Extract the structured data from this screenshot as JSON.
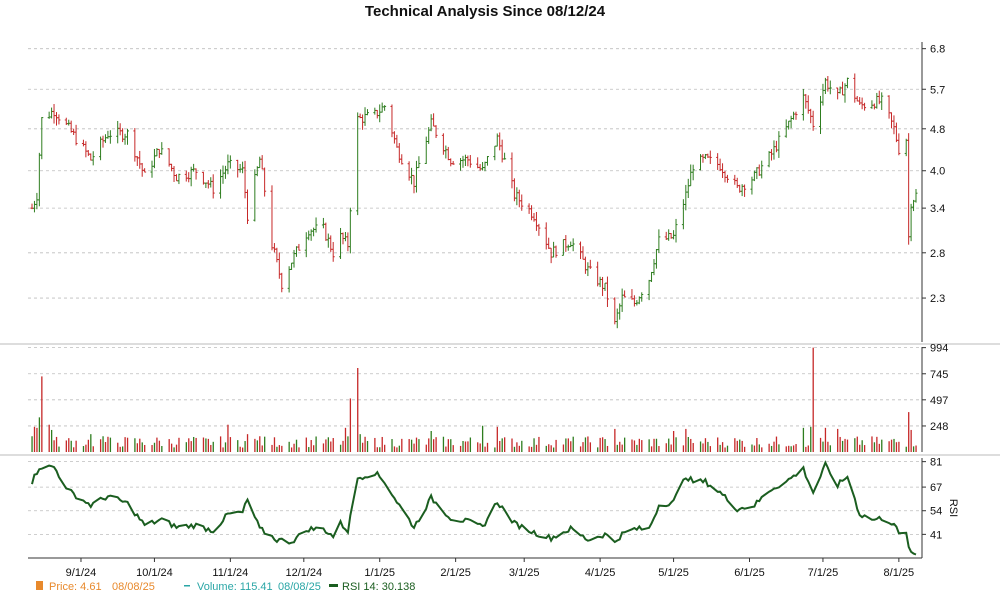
{
  "chart_data": {
    "type": "ohlc",
    "title": "Technical Analysis Since 08/12/24",
    "colors": {
      "up": "#2e7d1f",
      "down": "#c62828",
      "volume": "#c62828",
      "volume_up": "#2e7d1f",
      "rsi": "#1b5e20",
      "price_legend": "#e8892c",
      "volume_legend": "#2aa6a6",
      "rsi_legend": "#1b5e20"
    },
    "panels": {
      "price": {
        "ylim": [
          1.9,
          7.0
        ],
        "y_ticks": [
          "6.8",
          "5.7",
          "4.8",
          "4.0",
          "3.4",
          "2.8",
          "2.3"
        ],
        "y_tick_values": [
          6.8,
          5.7,
          4.8,
          4.0,
          3.4,
          2.8,
          2.3
        ],
        "scale": "log",
        "grid": true
      },
      "volume": {
        "ylim": [
          0,
          1000
        ],
        "y_ticks": [
          "994",
          "745",
          "497",
          "248"
        ],
        "y_tick_values": [
          994,
          745,
          497,
          248
        ],
        "grid": true
      },
      "rsi": {
        "ylim": [
          28,
          83
        ],
        "y_ticks": [
          "81",
          "67",
          "54",
          "41"
        ],
        "y_tick_values": [
          81,
          67,
          54,
          41
        ],
        "ylabel": "RSI",
        "grid": true
      }
    },
    "x_ticks": [
      "9/1/24",
      "10/1/24",
      "11/1/24",
      "12/1/24",
      "1/1/25",
      "2/1/25",
      "3/1/25",
      "4/1/25",
      "5/1/25",
      "6/1/25",
      "7/1/25",
      "8/1/25"
    ],
    "x_tick_dates": [
      "2024-09-01",
      "2024-10-01",
      "2024-11-01",
      "2024-12-01",
      "2025-01-01",
      "2025-02-01",
      "2025-03-01",
      "2025-04-01",
      "2025-05-01",
      "2025-06-01",
      "2025-07-01",
      "2025-08-01"
    ],
    "date_range": [
      "2024-08-12",
      "2025-08-08"
    ],
    "price_anchors": [
      [
        "2024-08-12",
        3.4
      ],
      [
        "2024-08-14",
        3.6
      ],
      [
        "2024-08-16",
        5.0
      ],
      [
        "2024-08-21",
        5.2
      ],
      [
        "2024-08-27",
        4.8
      ],
      [
        "2024-09-05",
        4.2
      ],
      [
        "2024-09-12",
        4.7
      ],
      [
        "2024-09-20",
        4.7
      ],
      [
        "2024-09-27",
        3.9
      ],
      [
        "2024-10-03",
        4.4
      ],
      [
        "2024-10-10",
        3.9
      ],
      [
        "2024-10-18",
        4.0
      ],
      [
        "2024-10-25",
        3.7
      ],
      [
        "2024-10-31",
        4.1
      ],
      [
        "2024-11-06",
        4.0
      ],
      [
        "2024-11-08",
        3.3
      ],
      [
        "2024-11-13",
        4.2
      ],
      [
        "2024-11-18",
        2.9
      ],
      [
        "2024-11-22",
        2.45
      ],
      [
        "2024-11-26",
        2.7
      ],
      [
        "2024-12-03",
        3.1
      ],
      [
        "2024-12-09",
        3.1
      ],
      [
        "2024-12-13",
        2.8
      ],
      [
        "2024-12-16",
        3.0
      ],
      [
        "2024-12-19",
        2.9
      ],
      [
        "2024-12-23",
        5.0
      ],
      [
        "2024-12-30",
        5.1
      ],
      [
        "2025-01-03",
        5.3
      ],
      [
        "2025-01-08",
        4.4
      ],
      [
        "2025-01-15",
        3.8
      ],
      [
        "2025-01-22",
        4.9
      ],
      [
        "2025-01-30",
        4.2
      ],
      [
        "2025-02-06",
        4.2
      ],
      [
        "2025-02-12",
        4.0
      ],
      [
        "2025-02-18",
        4.6
      ],
      [
        "2025-02-25",
        3.6
      ],
      [
        "2025-03-05",
        3.3
      ],
      [
        "2025-03-12",
        2.8
      ],
      [
        "2025-03-20",
        2.95
      ],
      [
        "2025-03-27",
        2.6
      ],
      [
        "2025-04-03",
        2.4
      ],
      [
        "2025-04-07",
        2.05
      ],
      [
        "2025-04-10",
        2.3
      ],
      [
        "2025-04-15",
        2.25
      ],
      [
        "2025-04-21",
        2.5
      ],
      [
        "2025-04-25",
        2.95
      ],
      [
        "2025-05-01",
        3.0
      ],
      [
        "2025-05-06",
        3.6
      ],
      [
        "2025-05-09",
        4.1
      ],
      [
        "2025-05-14",
        4.2
      ],
      [
        "2025-05-20",
        4.1
      ],
      [
        "2025-05-27",
        3.7
      ],
      [
        "2025-06-03",
        3.9
      ],
      [
        "2025-06-10",
        4.3
      ],
      [
        "2025-06-16",
        4.8
      ],
      [
        "2025-06-23",
        5.5
      ],
      [
        "2025-06-27",
        4.9
      ],
      [
        "2025-07-02",
        5.9
      ],
      [
        "2025-07-07",
        5.5
      ],
      [
        "2025-07-11",
        5.9
      ],
      [
        "2025-07-16",
        5.3
      ],
      [
        "2025-07-22",
        5.4
      ],
      [
        "2025-07-25",
        5.4
      ],
      [
        "2025-07-30",
        4.8
      ],
      [
        "2025-08-01",
        4.4
      ],
      [
        "2025-08-04",
        4.6
      ],
      [
        "2025-08-05",
        3.0
      ],
      [
        "2025-08-06",
        3.5
      ],
      [
        "2025-08-08",
        3.6
      ]
    ],
    "rsi_anchors": [
      [
        "2024-08-12",
        70
      ],
      [
        "2024-08-15",
        78
      ],
      [
        "2024-08-21",
        78
      ],
      [
        "2024-08-27",
        65
      ],
      [
        "2024-09-05",
        57
      ],
      [
        "2024-09-12",
        62
      ],
      [
        "2024-09-20",
        58
      ],
      [
        "2024-09-27",
        46
      ],
      [
        "2024-10-04",
        49
      ],
      [
        "2024-10-10",
        45
      ],
      [
        "2024-10-18",
        46
      ],
      [
        "2024-10-25",
        43
      ],
      [
        "2024-10-31",
        52
      ],
      [
        "2024-11-06",
        53
      ],
      [
        "2024-11-08",
        60
      ],
      [
        "2024-11-13",
        44
      ],
      [
        "2024-11-20",
        38
      ],
      [
        "2024-11-26",
        37
      ],
      [
        "2024-12-03",
        44
      ],
      [
        "2024-12-09",
        44
      ],
      [
        "2024-12-13",
        40
      ],
      [
        "2024-12-16",
        47
      ],
      [
        "2024-12-19",
        43
      ],
      [
        "2024-12-23",
        72
      ],
      [
        "2024-12-30",
        75
      ],
      [
        "2025-01-03",
        70
      ],
      [
        "2025-01-08",
        59
      ],
      [
        "2025-01-15",
        45
      ],
      [
        "2025-01-22",
        61
      ],
      [
        "2025-01-30",
        50
      ],
      [
        "2025-02-06",
        48
      ],
      [
        "2025-02-12",
        45
      ],
      [
        "2025-02-18",
        59
      ],
      [
        "2025-02-25",
        47
      ],
      [
        "2025-03-05",
        42
      ],
      [
        "2025-03-12",
        39
      ],
      [
        "2025-03-20",
        44
      ],
      [
        "2025-03-27",
        38
      ],
      [
        "2025-04-03",
        41
      ],
      [
        "2025-04-07",
        37
      ],
      [
        "2025-04-10",
        41
      ],
      [
        "2025-04-15",
        44
      ],
      [
        "2025-04-21",
        44
      ],
      [
        "2025-04-25",
        57
      ],
      [
        "2025-05-01",
        59
      ],
      [
        "2025-05-06",
        73
      ],
      [
        "2025-05-09",
        70
      ],
      [
        "2025-05-14",
        70
      ],
      [
        "2025-05-20",
        64
      ],
      [
        "2025-05-27",
        55
      ],
      [
        "2025-06-03",
        57
      ],
      [
        "2025-06-10",
        66
      ],
      [
        "2025-06-16",
        70
      ],
      [
        "2025-06-23",
        77
      ],
      [
        "2025-06-27",
        64
      ],
      [
        "2025-07-02",
        79
      ],
      [
        "2025-07-07",
        68
      ],
      [
        "2025-07-11",
        73
      ],
      [
        "2025-07-16",
        52
      ],
      [
        "2025-07-22",
        49
      ],
      [
        "2025-07-25",
        50
      ],
      [
        "2025-07-30",
        47
      ],
      [
        "2025-08-01",
        41
      ],
      [
        "2025-08-04",
        41
      ],
      [
        "2025-08-05",
        35
      ],
      [
        "2025-08-06",
        30
      ],
      [
        "2025-08-08",
        30
      ]
    ],
    "volume_spikes": [
      [
        "2024-08-12",
        150
      ],
      [
        "2024-08-13",
        240
      ],
      [
        "2024-08-14",
        230
      ],
      [
        "2024-08-15",
        330
      ],
      [
        "2024-08-16",
        720
      ],
      [
        "2024-08-19",
        260
      ],
      [
        "2024-08-20",
        210
      ],
      [
        "2024-09-05",
        170
      ],
      [
        "2024-09-10",
        150
      ],
      [
        "2024-10-31",
        260
      ],
      [
        "2024-11-08",
        170
      ],
      [
        "2024-11-13",
        150
      ],
      [
        "2024-12-18",
        230
      ],
      [
        "2024-12-20",
        510
      ],
      [
        "2024-12-23",
        800
      ],
      [
        "2024-12-24",
        170
      ],
      [
        "2025-01-22",
        200
      ],
      [
        "2025-02-12",
        250
      ],
      [
        "2025-02-18",
        240
      ],
      [
        "2025-04-07",
        220
      ],
      [
        "2025-05-01",
        200
      ],
      [
        "2025-05-06",
        220
      ],
      [
        "2025-06-23",
        230
      ],
      [
        "2025-06-26",
        240
      ],
      [
        "2025-06-27",
        994
      ],
      [
        "2025-07-02",
        230
      ],
      [
        "2025-07-07",
        220
      ],
      [
        "2025-08-05",
        380
      ],
      [
        "2025-08-06",
        210
      ]
    ],
    "volume_base": 120,
    "legend": {
      "price": {
        "label": "Price: 4.61",
        "date": "08/08/25"
      },
      "volume": {
        "label": "Volume: 115.41",
        "date": "08/08/25"
      },
      "rsi": {
        "label": "RSI 14: 30.138"
      }
    }
  }
}
